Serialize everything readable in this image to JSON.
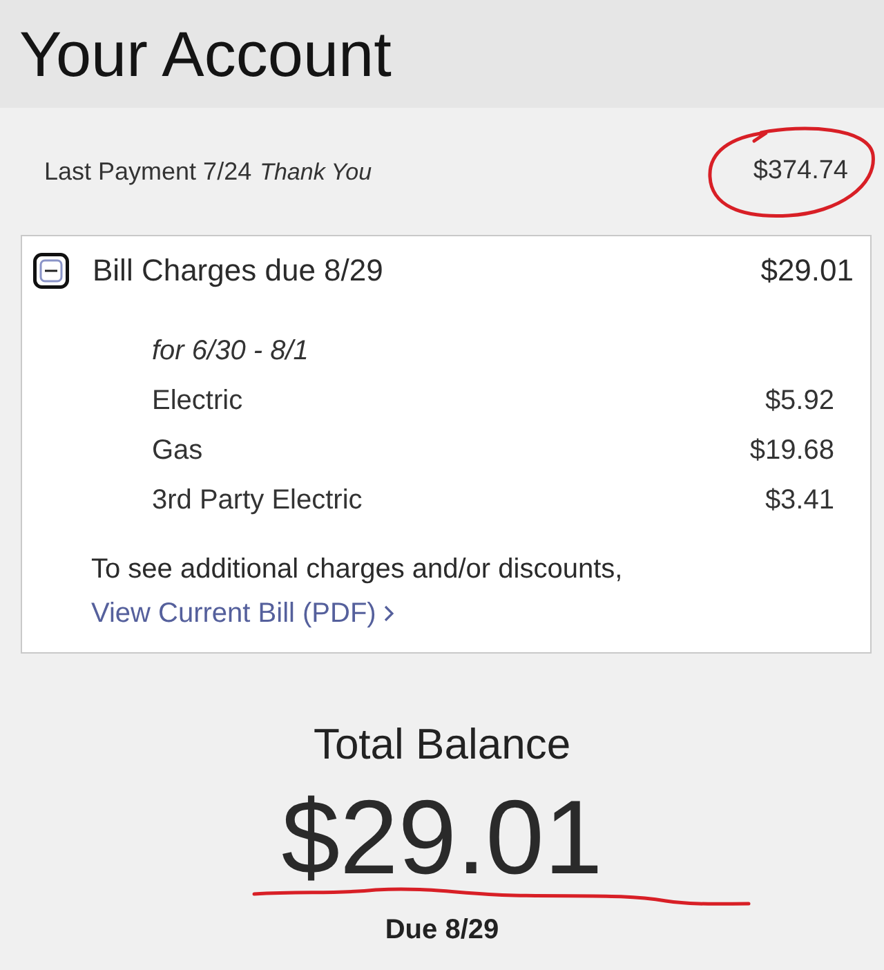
{
  "header": {
    "title": "Your Account"
  },
  "last_payment": {
    "label": "Last Payment 7/24",
    "note": "Thank You",
    "amount": "$374.74",
    "circled": true
  },
  "bill_charges": {
    "title": "Bill Charges due 8/29",
    "amount": "$29.01",
    "expanded": true,
    "period": "for 6/30 - 8/1",
    "items": [
      {
        "name": "Electric",
        "amount": "$5.92"
      },
      {
        "name": "Gas",
        "amount": "$19.68"
      },
      {
        "name": "3rd Party Electric",
        "amount": "$3.41"
      }
    ],
    "note": "To see additional charges and/or discounts,",
    "link": "View Current Bill (PDF)"
  },
  "total_balance": {
    "label": "Total Balance",
    "amount": "$29.01",
    "underlined": true,
    "due": "Due 8/29"
  }
}
